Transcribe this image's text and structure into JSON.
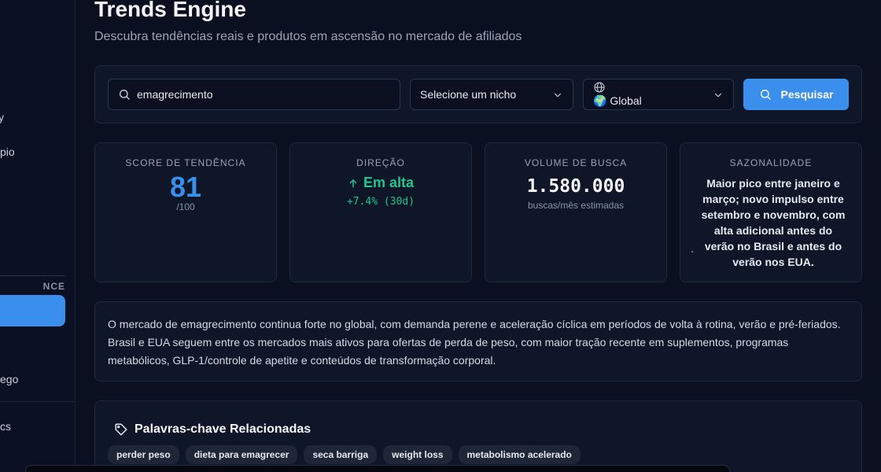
{
  "sidebar": {
    "items": [
      {
        "id": "a",
        "label": "y"
      },
      {
        "id": "b",
        "label": "pio"
      },
      {
        "id": "c",
        "label": "ego"
      },
      {
        "id": "d",
        "label": "cs"
      }
    ],
    "section_label": "NCE"
  },
  "header": {
    "title": "Trends Engine",
    "subtitle": "Descubra tendências reais e produtos em ascensão no mercado de afiliados"
  },
  "search": {
    "value": "emagrecimento",
    "niche_placeholder": "Selecione um nicho",
    "region_value": "🌍 Global",
    "button_label": "Pesquisar"
  },
  "metrics": {
    "score": {
      "label": "Score de Tendência",
      "value": "81",
      "max": "/100"
    },
    "direction": {
      "label": "Direção",
      "value": "Em alta",
      "change": "+7.4% (30d)"
    },
    "volume": {
      "label": "Volume de Busca",
      "value": "1.580.000",
      "sub": "buscas/mês estimadas"
    },
    "seasonality": {
      "label": "Sazonalidade",
      "text": "Maior pico entre janeiro e março; novo impulso entre setembro e novembro, com alta adicional antes do verão no Brasil e antes do verão nos EUA."
    }
  },
  "summary": "O mercado de emagrecimento continua forte no global, com demanda perene e aceleração cíclica em períodos de volta à rotina, verão e pré-feriados. Brasil e EUA seguem entre os mercados mais ativos para ofertas de perda de peso, com maior tração recente em suplementos, programas metabólicos, GLP-1/controle de apetite e conteúdos de transformação corporal.",
  "keywords": {
    "title": "Palavras-chave Relacionadas",
    "items": [
      "perder peso",
      "dieta para emagrecer",
      "seca barriga",
      "weight loss",
      "metabolismo acelerado"
    ]
  },
  "colors": {
    "accent": "#3b8fec",
    "positive": "#22c58b",
    "background": "#0a1020",
    "card": "#0e1628"
  },
  "icons": [
    "search-icon",
    "chevron-down-icon",
    "globe-icon",
    "arrow-up-icon",
    "tag-icon"
  ]
}
